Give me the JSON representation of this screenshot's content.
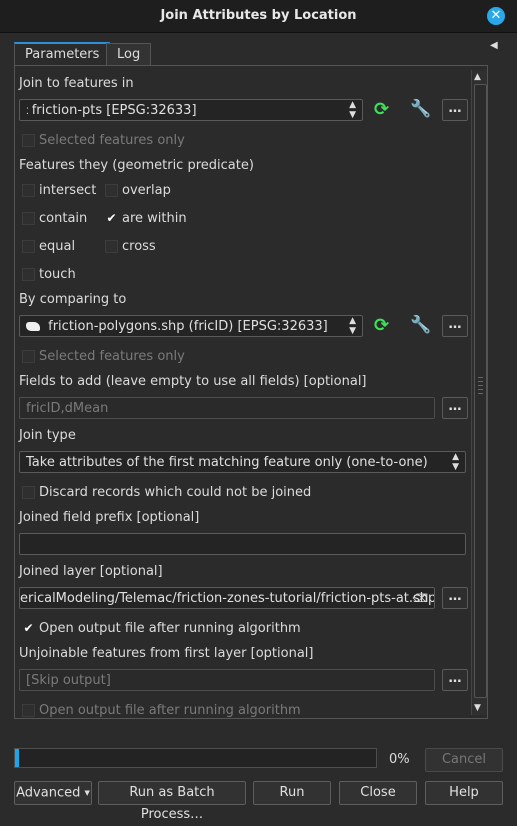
{
  "window": {
    "title": "Join Attributes by Location"
  },
  "tabs": [
    {
      "label": "Parameters"
    },
    {
      "label": "Log"
    }
  ],
  "join_to": {
    "label": "Join to features in",
    "layer": "friction-pts [EPSG:32633]",
    "selected_only": "Selected features only"
  },
  "predicate": {
    "label": "Features they (geometric predicate)",
    "options": [
      {
        "label": "intersect",
        "checked": false
      },
      {
        "label": "overlap",
        "checked": false
      },
      {
        "label": "contain",
        "checked": false
      },
      {
        "label": "are within",
        "checked": true
      },
      {
        "label": "equal",
        "checked": false
      },
      {
        "label": "cross",
        "checked": false
      },
      {
        "label": "touch",
        "checked": false
      }
    ]
  },
  "compare_to": {
    "label": "By comparing to",
    "layer": "friction-polygons.shp (fricID) [EPSG:32633]",
    "selected_only": "Selected features only"
  },
  "fields": {
    "label": "Fields to add (leave empty to use all fields) [optional]",
    "value": "fricID,dMean"
  },
  "join_type": {
    "label": "Join type",
    "value": "Take attributes of the first matching feature only (one-to-one)"
  },
  "discard": {
    "label": "Discard records which could not be joined",
    "checked": false
  },
  "prefix": {
    "label": "Joined field prefix [optional]",
    "value": ""
  },
  "joined_layer": {
    "label": "Joined layer [optional]",
    "value": "ericalModeling/Telemac/friction-zones-tutorial/friction-pts-at.shp",
    "open_output": "Open output file after running algorithm",
    "open_checked": true
  },
  "unjoinable": {
    "label": "Unjoinable features from first layer [optional]",
    "placeholder": "[Skip output]",
    "open_output": "Open output file after running algorithm"
  },
  "progress": {
    "value": 0.01,
    "text": "0%"
  },
  "buttons": {
    "cancel": "Cancel",
    "advanced": "Advanced",
    "batch": "Run as Batch Process…",
    "run": "Run",
    "close": "Close",
    "help": "Help"
  },
  "icons": [
    "close-icon",
    "point-layer-icon",
    "polygon-layer-icon",
    "sync-icon",
    "wrench-icon",
    "clear-icon",
    "chevron-down-icon"
  ],
  "colors": {
    "accent": "#1ea7e8",
    "sync": "#3ee05a",
    "wrench": "#e8c04a"
  }
}
